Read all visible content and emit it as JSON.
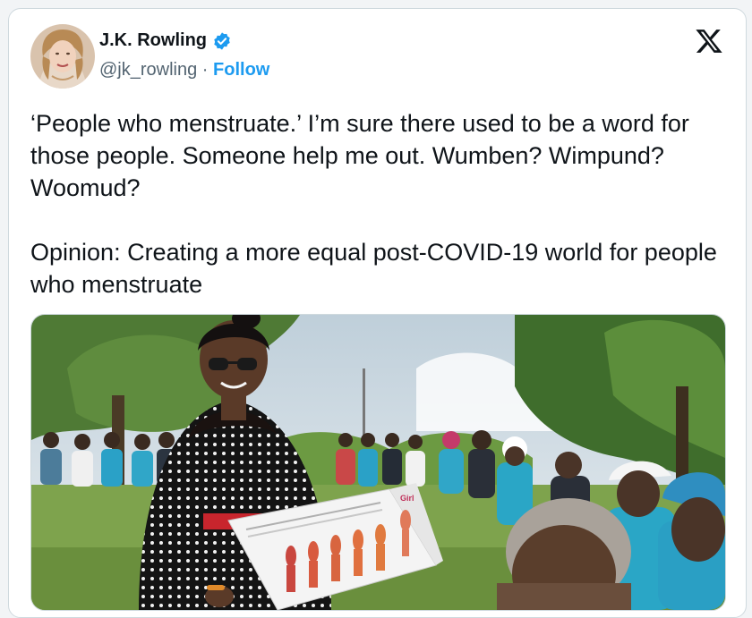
{
  "author": {
    "display_name": "J.K. Rowling",
    "handle": "@jk_rowling",
    "separator": "·",
    "follow_label": "Follow",
    "verified": true
  },
  "tweet": {
    "text": "‘People who menstruate.’ I’m sure there used to be a word for those people. Someone help me out. Wumben? Wimpund? Woomud?\n\nOpinion: Creating a more equal post-COVID-19 world for people who menstruate"
  },
  "media": {
    "chart_heading": "Girl"
  },
  "icons": {
    "platform": "x-logo-icon",
    "verified": "verified-badge-icon"
  },
  "colors": {
    "accent": "#1d9bf0",
    "text_primary": "#0f1419",
    "text_secondary": "#536471",
    "border": "#cfd9de"
  }
}
